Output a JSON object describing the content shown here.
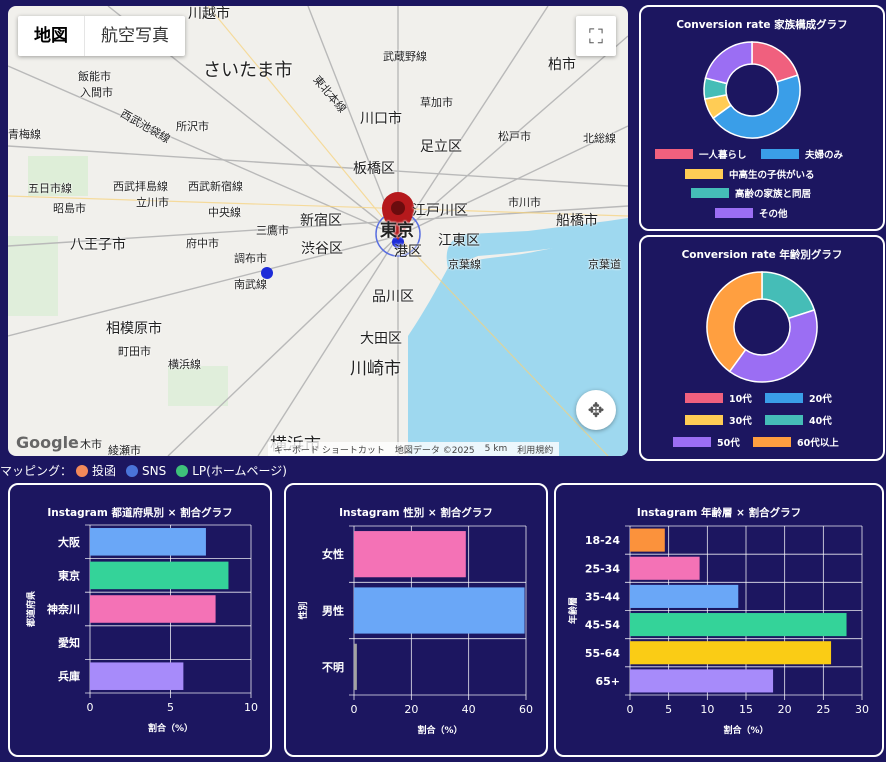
{
  "map": {
    "type_buttons": [
      "地図",
      "航空写真"
    ],
    "labels": [
      {
        "text": "川越市",
        "size": 14
      },
      {
        "text": "さいたま市",
        "size": 18
      },
      {
        "text": "武蔵野線",
        "size": 11
      },
      {
        "text": "柏市",
        "size": 14
      },
      {
        "text": "飯能市",
        "size": 11
      },
      {
        "text": "入間市",
        "size": 11
      },
      {
        "text": "所沢市",
        "size": 11
      },
      {
        "text": "川口市",
        "size": 14
      },
      {
        "text": "草加市",
        "size": 11
      },
      {
        "text": "松戸市",
        "size": 11
      },
      {
        "text": "北総線",
        "size": 11
      },
      {
        "text": "足立区",
        "size": 14
      },
      {
        "text": "板橋区",
        "size": 14
      },
      {
        "text": "五日市線",
        "size": 11
      },
      {
        "text": "昭島市",
        "size": 11
      },
      {
        "text": "西武拝島線",
        "size": 11
      },
      {
        "text": "西武新宿線",
        "size": 11
      },
      {
        "text": "立川市",
        "size": 11
      },
      {
        "text": "中央線",
        "size": 11
      },
      {
        "text": "三鷹市",
        "size": 11
      },
      {
        "text": "新宿区",
        "size": 14
      },
      {
        "text": "江戸川区",
        "size": 14
      },
      {
        "text": "市川市",
        "size": 11
      },
      {
        "text": "船橋市",
        "size": 14
      },
      {
        "text": "八王子市",
        "size": 14
      },
      {
        "text": "府中市",
        "size": 11
      },
      {
        "text": "調布市",
        "size": 11
      },
      {
        "text": "渋谷区",
        "size": 14
      },
      {
        "text": "東京",
        "size": 17
      },
      {
        "text": "江東区",
        "size": 14
      },
      {
        "text": "港区",
        "size": 14
      },
      {
        "text": "京葉線",
        "size": 11
      },
      {
        "text": "京葉道",
        "size": 11
      },
      {
        "text": "南武線",
        "size": 11
      },
      {
        "text": "品川区",
        "size": 14
      },
      {
        "text": "相模原市",
        "size": 14
      },
      {
        "text": "町田市",
        "size": 11
      },
      {
        "text": "大田区",
        "size": 14
      },
      {
        "text": "横浜線",
        "size": 11
      },
      {
        "text": "川崎市",
        "size": 17
      },
      {
        "text": "木市",
        "size": 11
      },
      {
        "text": "綾瀬市",
        "size": 11
      },
      {
        "text": "横浜市",
        "size": 17
      },
      {
        "text": "東北本線",
        "size": 11
      },
      {
        "text": "西武池袋線",
        "size": 11
      },
      {
        "text": "青梅線",
        "size": 11
      }
    ],
    "footer": [
      "キーボード ショートカット",
      "地図データ ©2025",
      "5 km",
      "利用規約"
    ],
    "google_logo": "Google"
  },
  "mapping": {
    "label": "マッピング：",
    "items": [
      {
        "label": "投函",
        "color": "#f48a5a"
      },
      {
        "label": "SNS",
        "color": "#4a74d9"
      },
      {
        "label": "LP(ホームページ)",
        "color": "#3ec27a"
      }
    ]
  },
  "family_chart": {
    "title": "Conversion rate 家族構成グラフ",
    "chart_data": {
      "type": "pie",
      "title": "Conversion rate 家族構成グラフ",
      "categories": [
        "一人暮らし",
        "夫婦のみ",
        "中高生の子供がいる",
        "高齢の家族と同居",
        "その他"
      ],
      "values": [
        20,
        45,
        7,
        7,
        21
      ],
      "colors": [
        "#f0607e",
        "#3a9ee8",
        "#ffcc55",
        "#45bdb7",
        "#9b6ef3"
      ]
    }
  },
  "age_chart": {
    "title": "Conversion rate 年齢別グラフ",
    "chart_data": {
      "type": "pie",
      "title": "Conversion rate 年齢別グラフ",
      "categories": [
        "10代",
        "20代",
        "30代",
        "40代",
        "50代",
        "60代以上"
      ],
      "values": [
        0,
        0,
        0,
        20,
        40,
        40
      ],
      "colors": [
        "#f0607e",
        "#3a9ee8",
        "#ffcc55",
        "#45bdb7",
        "#9b6ef3",
        "#ff9f40"
      ]
    }
  },
  "pref_chart": {
    "title": "Instagram 都道府県別 × 割合グラフ",
    "chart_data": {
      "type": "bar",
      "orientation": "horizontal",
      "title": "Instagram 都道府県別 × 割合グラフ",
      "categories": [
        "大阪",
        "東京",
        "神奈川",
        "愛知",
        "兵庫"
      ],
      "values": [
        7.2,
        8.6,
        7.8,
        0,
        5.8
      ],
      "colors": [
        "#6aa7f7",
        "#34d399",
        "#f472b6",
        "#fbbf24",
        "#a78bfa"
      ],
      "xlabel": "割合（%）",
      "ylabel": "都道府県",
      "xlim": [
        0,
        10
      ],
      "ticks": [
        0,
        5,
        10
      ],
      "grid": true
    }
  },
  "gender_chart": {
    "title": "Instagram 性別 × 割合グラフ",
    "chart_data": {
      "type": "bar",
      "orientation": "horizontal",
      "title": "Instagram 性別 × 割合グラフ",
      "categories": [
        "女性",
        "男性",
        "不明"
      ],
      "values": [
        39,
        59.5,
        1
      ],
      "colors": [
        "#f472b6",
        "#6aa7f7",
        "#a3a3a3"
      ],
      "xlabel": "割合（%）",
      "ylabel": "性別",
      "xlim": [
        0,
        60
      ],
      "ticks": [
        0,
        20,
        40,
        60
      ],
      "grid": true
    }
  },
  "agegroup_chart": {
    "title": "Instagram 年齢層 × 割合グラフ",
    "chart_data": {
      "type": "bar",
      "orientation": "horizontal",
      "title": "Instagram 年齢層 × 割合グラフ",
      "categories": [
        "18-24",
        "25-34",
        "35-44",
        "45-54",
        "55-64",
        "65+"
      ],
      "values": [
        4.5,
        9,
        14,
        28,
        26,
        18.5
      ],
      "colors": [
        "#fb923c",
        "#f472b6",
        "#6aa7f7",
        "#34d399",
        "#facc15",
        "#a78bfa"
      ],
      "xlabel": "割合（%）",
      "ylabel": "年齢層",
      "xlim": [
        0,
        30
      ],
      "ticks": [
        0,
        5,
        10,
        15,
        20,
        25,
        30
      ],
      "grid": true
    }
  }
}
